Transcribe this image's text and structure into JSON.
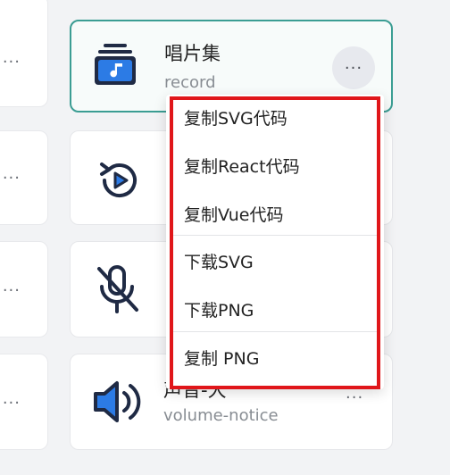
{
  "cards": [
    {
      "title": "唱片集",
      "subtitle": "record",
      "icon": "record-album-icon",
      "active": true
    },
    {
      "title": "",
      "subtitle": "",
      "icon": "replay-play-icon",
      "active": false
    },
    {
      "title": "",
      "subtitle": "",
      "icon": "mic-off-icon",
      "active": false
    },
    {
      "title": "声音-大",
      "subtitle": "volume-notice",
      "icon": "volume-notice-icon",
      "active": false
    }
  ],
  "more_label": "···",
  "menu": {
    "items": [
      {
        "label": "复制SVG代码"
      },
      {
        "label": "复制React代码"
      },
      {
        "label": "复制Vue代码"
      },
      {
        "label": "下载SVG"
      },
      {
        "label": "下载PNG"
      },
      {
        "label": "复制 PNG"
      }
    ]
  },
  "colors": {
    "accent_border": "#3b9d93",
    "highlight": "#e0161a",
    "icon_blue": "#1f6fd6",
    "icon_dark": "#1f2a44"
  }
}
